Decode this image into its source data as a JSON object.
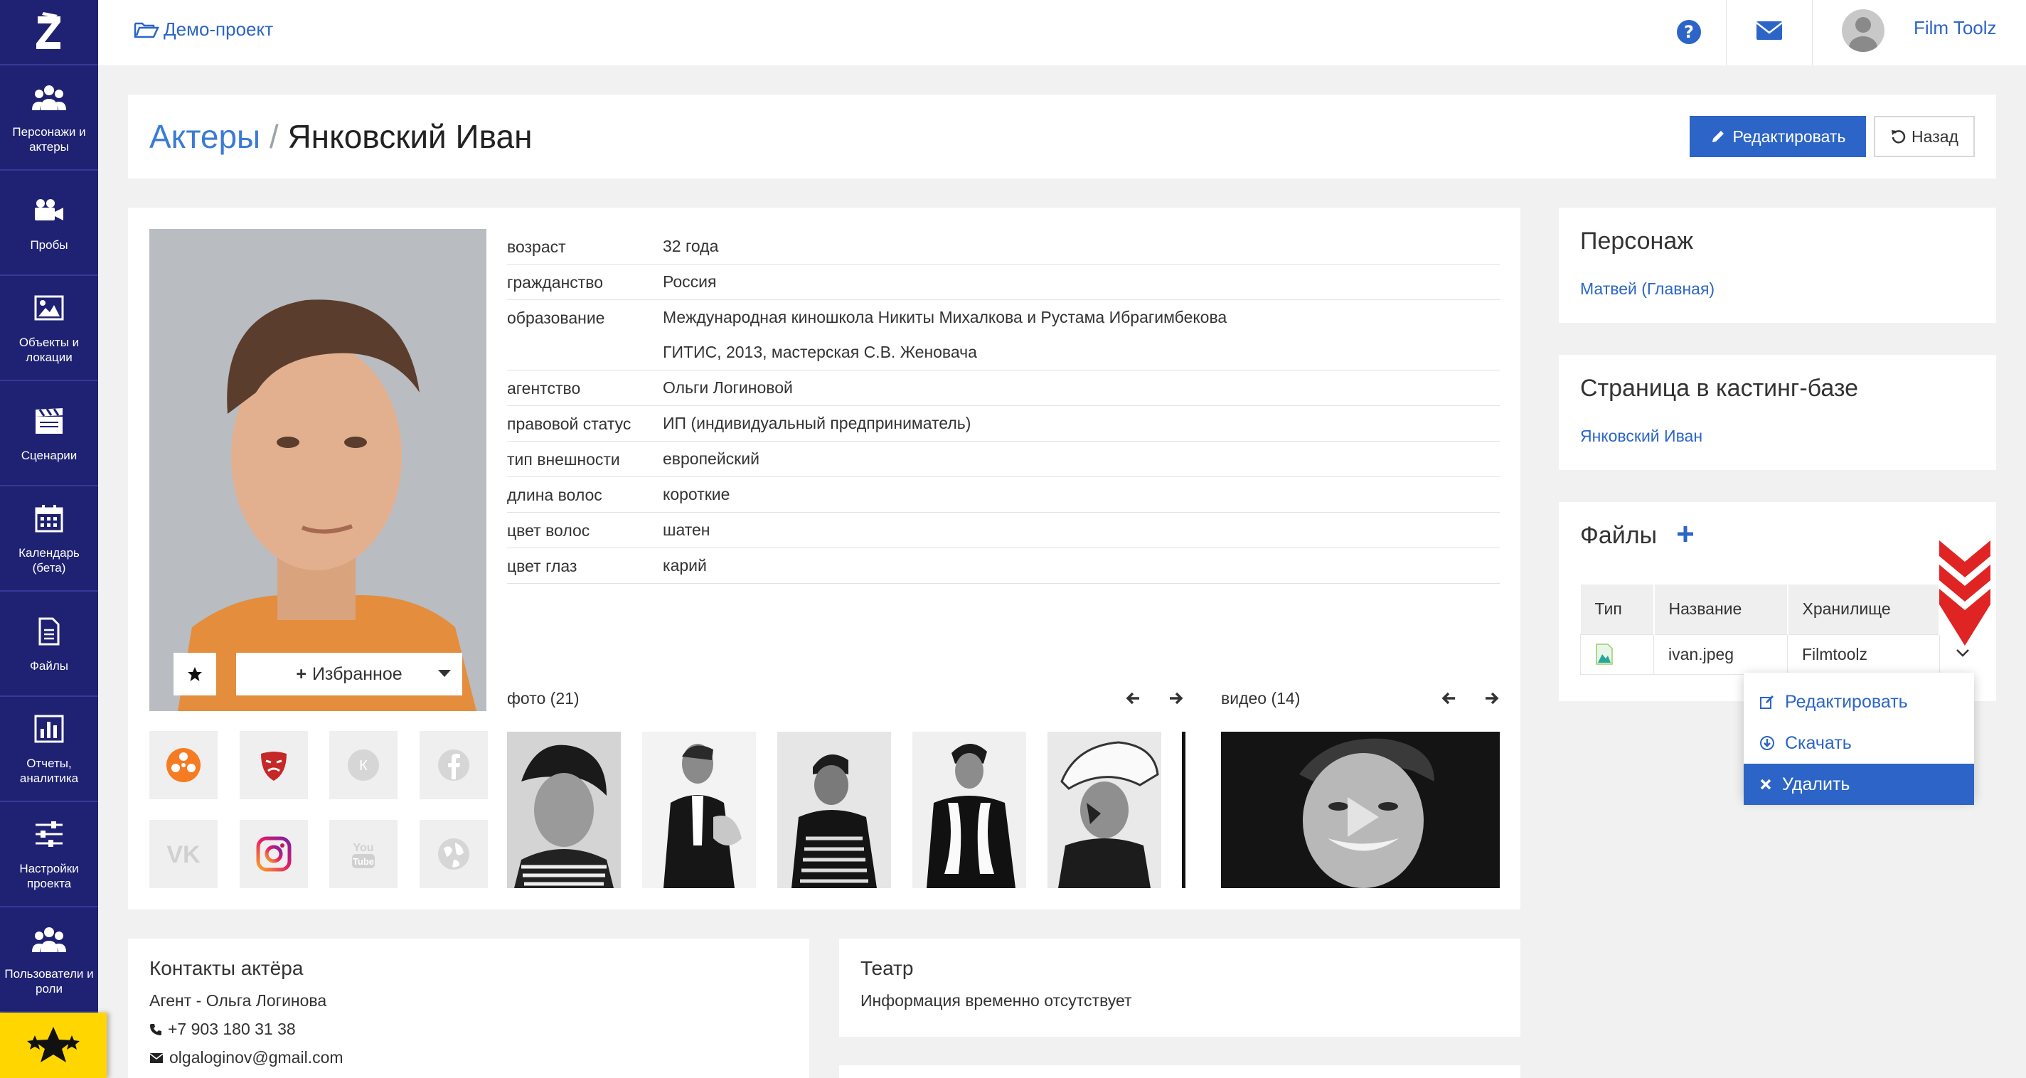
{
  "colors": {
    "sidebar": "#1f2272",
    "accent": "#2c65c7",
    "highlight": "#ffd600",
    "marker": "#e02424"
  },
  "sidebar": {
    "items": [
      {
        "label": "Персонажи и актеры",
        "icon": "users-icon"
      },
      {
        "label": "Пробы",
        "icon": "video-camera-icon"
      },
      {
        "label": "Объекты и локации",
        "icon": "image-icon"
      },
      {
        "label": "Сценарии",
        "icon": "clapperboard-icon"
      },
      {
        "label": "Календарь (бета)",
        "icon": "calendar-icon"
      },
      {
        "label": "Файлы",
        "icon": "file-icon"
      },
      {
        "label": "Отчеты, аналитика",
        "icon": "bar-chart-icon"
      },
      {
        "label": "Настройки проекта",
        "icon": "sliders-icon"
      },
      {
        "label": "Пользователи и роли",
        "icon": "users-icon"
      }
    ]
  },
  "topbar": {
    "project": "Демо-проект",
    "user": "Film Toolz"
  },
  "header": {
    "crumb_link": "Актеры",
    "separator": "/",
    "actor_name": "Янковский Иван",
    "edit_button": "Редактировать",
    "back_button": "Назад"
  },
  "profile": {
    "favorite_label": "Избранное",
    "attributes": [
      {
        "key": "возраст",
        "values": [
          "32 года"
        ]
      },
      {
        "key": "гражданство",
        "values": [
          "Россия"
        ]
      },
      {
        "key": "образование",
        "values": [
          "Международная киношкола Никиты Михалкова и Рустама Ибрагимбекова",
          "ГИТИС, 2013, мастерская С.В. Женовача"
        ]
      },
      {
        "key": "агентство",
        "values": [
          "Ольги Логиновой"
        ]
      },
      {
        "key": "правовой статус",
        "values": [
          "ИП (индивидуальный предприниматель)"
        ]
      },
      {
        "key": "тип внешности",
        "values": [
          "европейский"
        ]
      },
      {
        "key": "длина волос",
        "values": [
          "короткие"
        ]
      },
      {
        "key": "цвет волос",
        "values": [
          "шатен"
        ]
      },
      {
        "key": "цвет глаз",
        "values": [
          "карий"
        ]
      }
    ],
    "photos_label": "фото (21)",
    "videos_label": "видео (14)"
  },
  "contacts": {
    "title": "Контакты актёра",
    "agent": "Агент - Ольга Логинова",
    "phone": "+7 903 180 31 38",
    "email": "olgaloginov@gmail.com"
  },
  "theatre": {
    "title": "Театр",
    "text": "Информация временно отсутствует"
  },
  "character": {
    "title": "Персонаж",
    "link": "Матвей (Главная)"
  },
  "casting": {
    "title": "Страница в кастинг-базе",
    "link": "Янковский Иван"
  },
  "files": {
    "title": "Файлы",
    "columns": [
      "Тип",
      "Название",
      "Хранилище"
    ],
    "rows": [
      {
        "name": "ivan.jpeg",
        "storage": "Filmtoolz"
      }
    ]
  },
  "dropdown": {
    "items": [
      {
        "label": "Редактировать",
        "icon": "edit-icon"
      },
      {
        "label": "Скачать",
        "icon": "download-icon"
      },
      {
        "label": "Удалить",
        "icon": "times-icon"
      }
    ],
    "active": "Удалить"
  }
}
